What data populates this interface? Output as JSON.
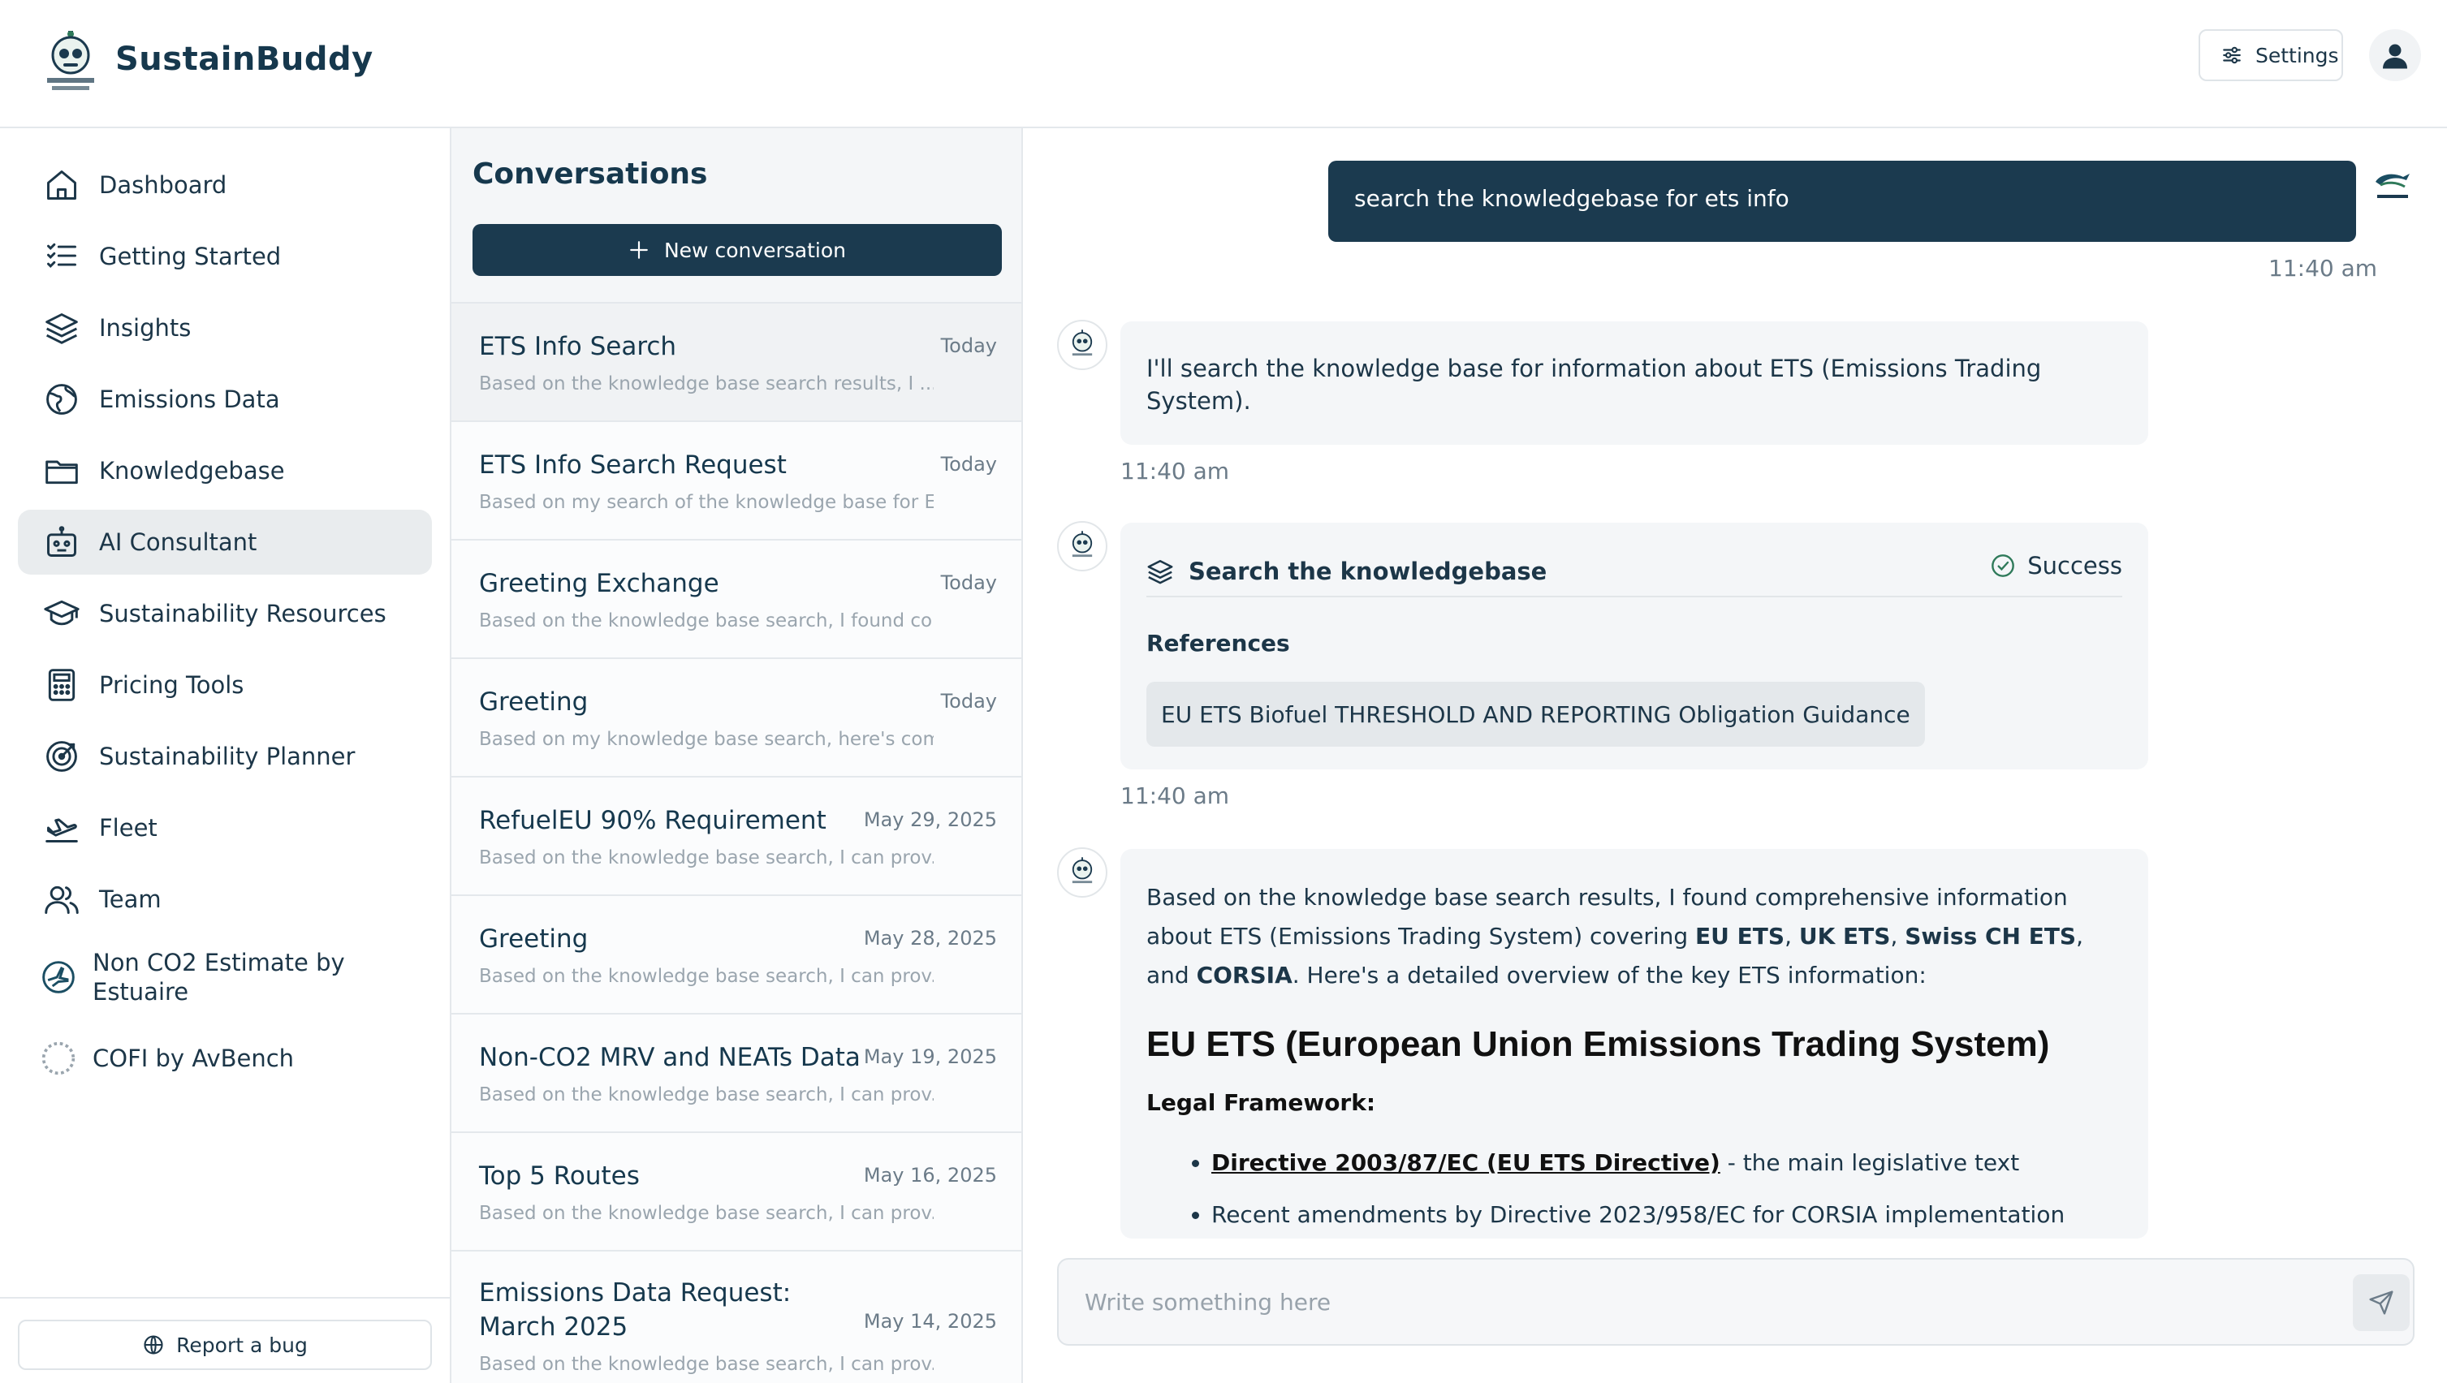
{
  "app": {
    "brand": "SustainBuddy"
  },
  "header": {
    "settings_label": "Settings"
  },
  "sidebar": {
    "items": [
      {
        "label": "Dashboard",
        "icon": "home-icon"
      },
      {
        "label": "Getting Started",
        "icon": "checklist-icon"
      },
      {
        "label": "Insights",
        "icon": "layers-icon"
      },
      {
        "label": "Emissions Data",
        "icon": "globe-icon"
      },
      {
        "label": "Knowledgebase",
        "icon": "folder-icon"
      },
      {
        "label": "AI Consultant",
        "icon": "robot-icon",
        "active": true
      },
      {
        "label": "Sustainability Resources",
        "icon": "graduation-cap-icon"
      },
      {
        "label": "Pricing Tools",
        "icon": "calculator-icon"
      },
      {
        "label": "Sustainability Planner",
        "icon": "target-icon"
      },
      {
        "label": "Fleet",
        "icon": "plane-takeoff-icon"
      },
      {
        "label": "Team",
        "icon": "users-icon"
      },
      {
        "label": "Non CO2 Estimate by Estuaire",
        "icon": "estuaire-logo-icon"
      },
      {
        "label": "COFI by AvBench",
        "icon": "avbench-logo-icon"
      }
    ],
    "bug_label": "Report a bug"
  },
  "conversations": {
    "title": "Conversations",
    "new_label": "New conversation",
    "items": [
      {
        "title": "ETS Info Search",
        "date": "Today",
        "preview": "Based on the knowledge base search results, I ..."
      },
      {
        "title": "ETS Info Search Request",
        "date": "Today",
        "preview": "Based on my search of the knowledge base for E..."
      },
      {
        "title": "Greeting Exchange",
        "date": "Today",
        "preview": "Based on the knowledge base search, I found co..."
      },
      {
        "title": "Greeting",
        "date": "Today",
        "preview": "Based on my knowledge base search, here's comp..."
      },
      {
        "title": "RefuelEU 90% Requirement",
        "date": "May 29, 2025",
        "preview": "Based on the knowledge base search, I can prov..."
      },
      {
        "title": "Greeting",
        "date": "May 28, 2025",
        "preview": "Based on the knowledge base search, I can prov..."
      },
      {
        "title": "Non-CO2 MRV and NEATs Data",
        "date": "May 19, 2025",
        "preview": "Based on the knowledge base search, I can prov..."
      },
      {
        "title": "Top 5 Routes",
        "date": "May 16, 2025",
        "preview": "Based on the knowledge base search, I can prov..."
      },
      {
        "title": "Emissions Data Request: March 2025",
        "date": "May 14, 2025",
        "preview": "Based on the knowledge base search, I can prov..."
      }
    ]
  },
  "chat": {
    "user_message": "search the knowledgebase for ets info",
    "user_time": "11:40 am",
    "bot_message_1": "I'll search the knowledge base for information about ETS (Emissions Trading System).",
    "bot_time_1": "11:40 am",
    "tool": {
      "name": "Search the knowledgebase",
      "status": "Success",
      "references_title": "References",
      "references": [
        "EU ETS Biofuel THRESHOLD AND REPORTING Obligation Guidance"
      ]
    },
    "bot_time_2": "11:40 am",
    "answer": {
      "intro_1": "Based on the knowledge base search results, I found comprehensive information about ETS (Emissions Trading System) covering ",
      "b1": "EU ETS",
      "sep1": ", ",
      "b2": "UK ETS",
      "sep2": ", ",
      "b3": "Swiss CH ETS",
      "sep3": ", and ",
      "b4": "CORSIA",
      "intro_2": ". Here's a detailed overview of the key ETS information:",
      "heading": "EU ETS (European Union Emissions Trading System)",
      "subheading": "Legal Framework:",
      "bullet1_link": "Directive 2003/87/EC (EU ETS Directive)",
      "bullet1_rest": " - the main legislative text",
      "bullet2": "Recent amendments by Directive 2023/958/EC for CORSIA implementation"
    },
    "composer_placeholder": "Write something here"
  }
}
